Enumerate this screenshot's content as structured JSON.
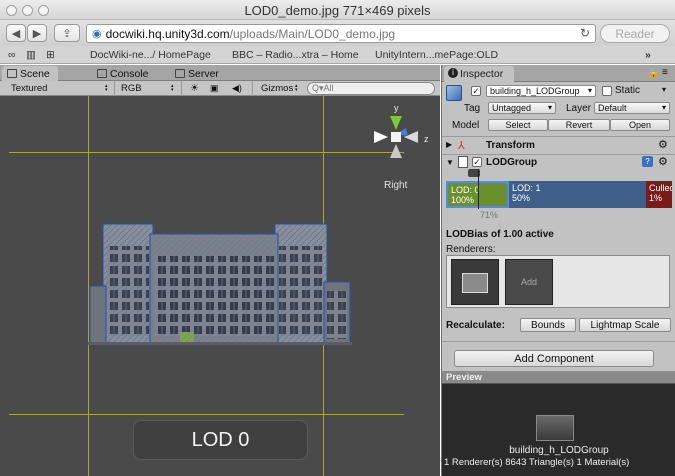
{
  "window": {
    "title": "LOD0_demo.jpg 771×469 pixels"
  },
  "browser": {
    "url_host": "docwiki.hq.unity3d.com",
    "url_path": "/uploads/Main/LOD0_demo.jpg",
    "reader_label": "Reader",
    "bookmarks": [
      "DocWiki-ne.../ HomePage",
      "BBC – Radio...xtra – Home",
      "UnityIntern...mePage:OLD"
    ],
    "more_bookmarks": "»"
  },
  "editor": {
    "tabs": [
      "Scene",
      "Console",
      "Server"
    ],
    "scene_toolbar": {
      "render_mode": "Textured",
      "color_mode": "RGB",
      "gizmos_label": "Gizmos",
      "search_placeholder": "Q▾All"
    },
    "gizmo_axes": {
      "y": "y",
      "z": "z",
      "view_label": "Right"
    },
    "lod_overlay": "LOD 0"
  },
  "inspector": {
    "tab_label": "Inspector",
    "object_name": "building_h_LODGroup",
    "static_label": "Static",
    "tag_label": "Tag",
    "tag_value": "Untagged",
    "layer_label": "Layer",
    "layer_value": "Default",
    "model_label": "Model",
    "model_buttons": [
      "Select",
      "Revert",
      "Open"
    ],
    "transform_label": "Transform",
    "lodgroup_label": "LODGroup",
    "lod_levels": [
      {
        "name": "LOD: 0",
        "percent": "100%",
        "color": "#6b8f2a",
        "start": 1.0,
        "end": 0.5
      },
      {
        "name": "LOD: 1",
        "percent": "50%",
        "color": "#3d5f8a",
        "start": 0.5,
        "end": 0.01
      },
      {
        "name": "Culled",
        "percent": "1%",
        "color": "#7a1a1a",
        "start": 0.01,
        "end": 0.0
      }
    ],
    "camera_percent": "71%",
    "lodbias_text": "LODBias of 1.00 active",
    "renderers_label": "Renderers:",
    "add_label": "Add",
    "recalculate_label": "Recalculate:",
    "bounds_button": "Bounds",
    "lightmap_button": "Lightmap Scale",
    "add_component_button": "Add Component"
  },
  "preview": {
    "header": "Preview",
    "object_name": "building_h_LODGroup",
    "stats": "1 Renderer(s)   8643 Triangle(s)   1 Material(s)"
  },
  "colors": {
    "scene_bg": "#4a4a4a",
    "guide_line": "#a6a63c",
    "selection_blue": "#2a4fa8",
    "lod0": "#6b8f2a",
    "lod1": "#3d5f8a",
    "culled": "#7a1a1a"
  }
}
